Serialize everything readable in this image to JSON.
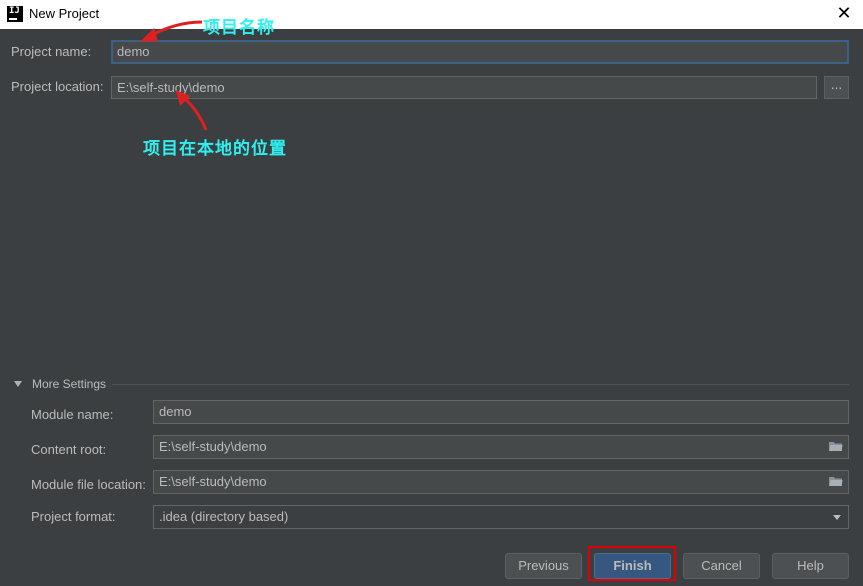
{
  "window": {
    "title": "New Project",
    "close_glyph": "✕",
    "app_icon": "intellij-icon"
  },
  "form": {
    "project_name_label": "Project name:",
    "project_name_value": "demo",
    "project_location_label": "Project location:",
    "project_location_value": "E:\\self-study\\demo",
    "browse_label": "..."
  },
  "annotations": {
    "name_note": "项目名称",
    "location_note": "项目在本地的位置",
    "color": "#2ff0f0",
    "arrow_color": "#e02020"
  },
  "more_settings": {
    "header": "More Settings",
    "expanded": true,
    "module_name_label": "Module name:",
    "module_name_value": "demo",
    "content_root_label": "Content root:",
    "content_root_value": "E:\\self-study\\demo",
    "module_file_location_label": "Module file location:",
    "module_file_location_value": "E:\\self-study\\demo",
    "project_format_label": "Project format:",
    "project_format_value": ".idea (directory based)"
  },
  "buttons": {
    "previous": "Previous",
    "finish": "Finish",
    "cancel": "Cancel",
    "help": "Help"
  },
  "colors": {
    "background": "#3c3f41",
    "primary_button": "#365880",
    "focus_border": "#3d6185",
    "highlight_box": "#e00000"
  }
}
